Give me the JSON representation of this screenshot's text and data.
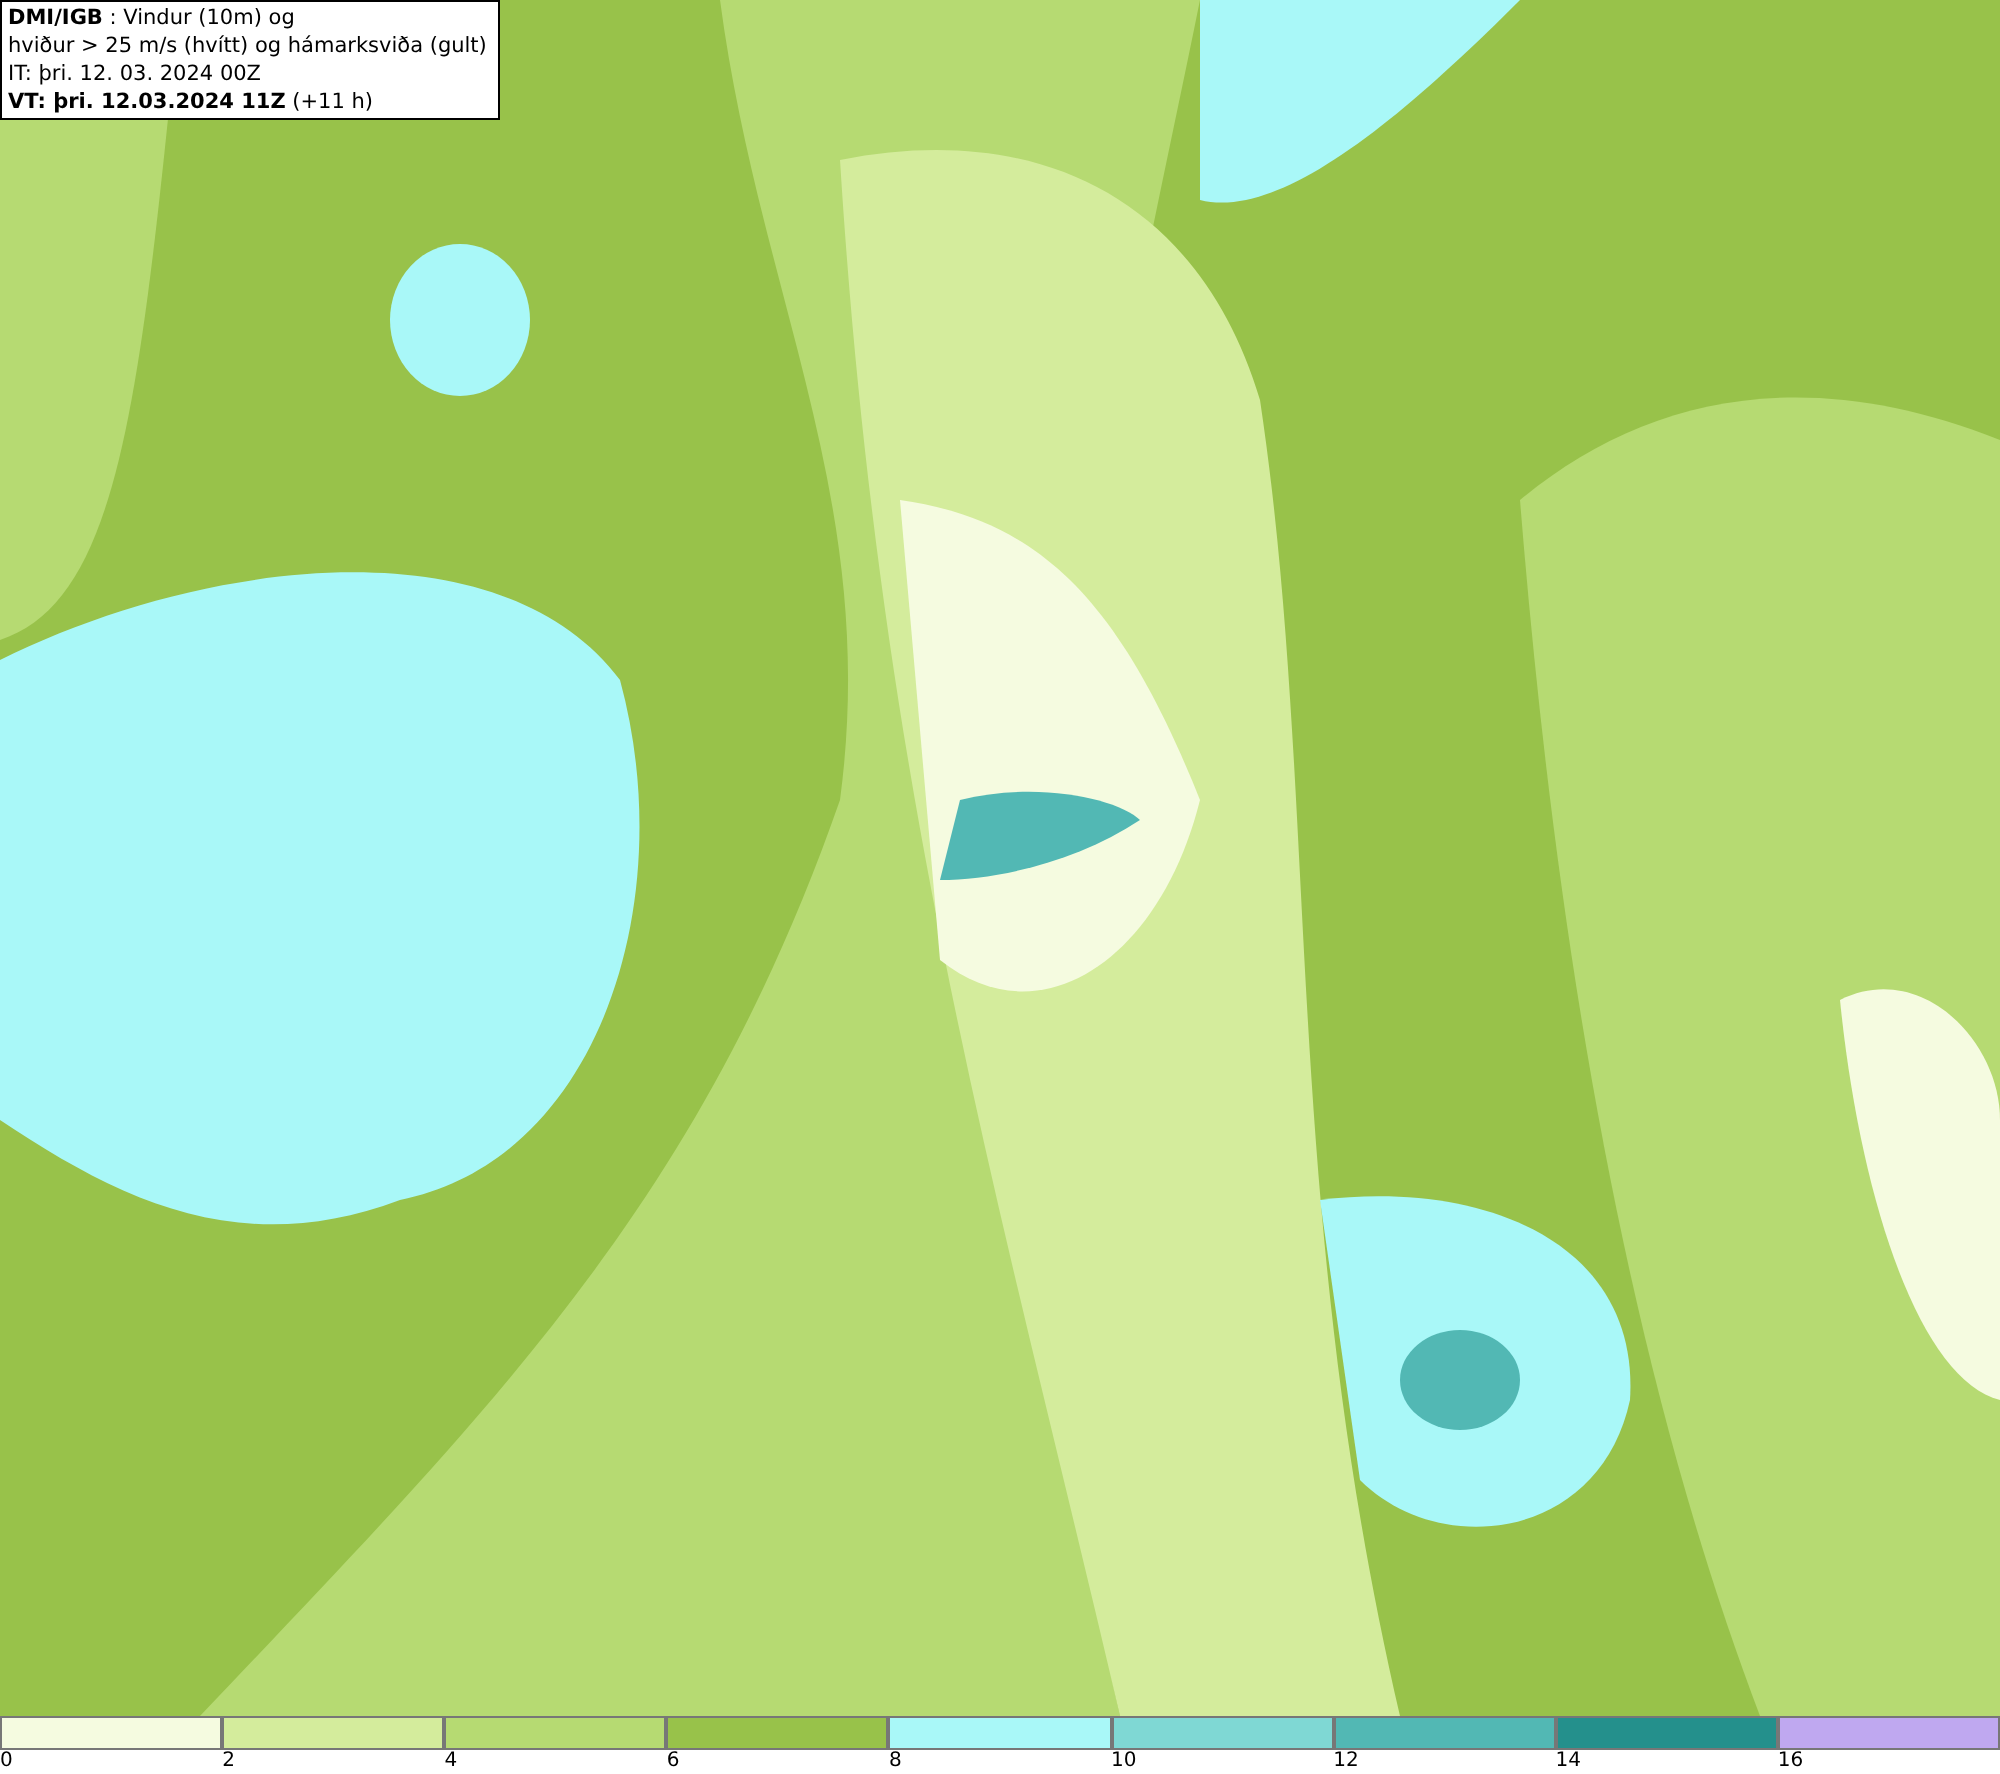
{
  "legend": {
    "lines": [
      "**DMI/IGB** : Vindur (10m) og",
      "hviður > 25 m/s (hvítt) og hámarksviða (gult)",
      "IT: þri. 12. 03. 2024 00Z",
      "**VT: þri. 12.03.2024 11Z** (+11 h)"
    ]
  },
  "color_scale": [
    {
      "label": "0",
      "color": "#f5fbe0"
    },
    {
      "label": "2",
      "color": "#d4ec9c"
    },
    {
      "label": "4",
      "color": "#b6da72"
    },
    {
      "label": "6",
      "color": "#98c24a"
    },
    {
      "label": "8",
      "color": "#a9f8f8"
    },
    {
      "label": "10",
      "color": "#7fd8d4"
    },
    {
      "label": "12",
      "color": "#52b8b4"
    },
    {
      "label": "14",
      "color": "#24908c"
    },
    {
      "label": "16",
      "color": "#bfa8f0"
    }
  ]
}
